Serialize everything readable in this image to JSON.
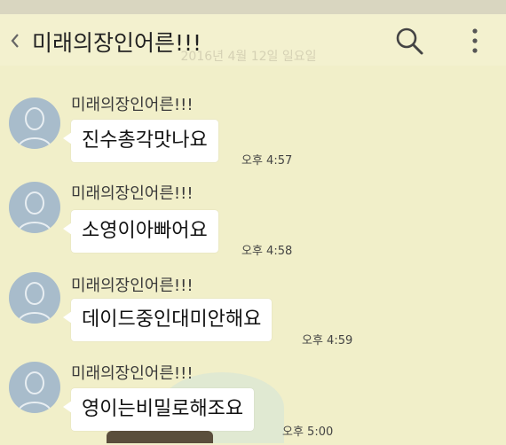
{
  "header": {
    "title": "미래의장인어른!!!"
  },
  "date_divider": "2016년 4월 12일 일요일",
  "messages": [
    {
      "sender": "미래의장인어른!!!",
      "text": "진수총각맛나요",
      "time": "오후 4:57"
    },
    {
      "sender": "미래의장인어른!!!",
      "text": "소영이아빠어요",
      "time": "오후 4:58"
    },
    {
      "sender": "미래의장인어른!!!",
      "text": "데이드중인대미안해요",
      "time": "오후 4:59"
    },
    {
      "sender": "미래의장인어른!!!",
      "text": "영이는비밀로해조요",
      "time": "오후 5:00"
    }
  ],
  "icons": {
    "back": "chevron-left-icon",
    "search": "search-icon",
    "more": "more-vertical-icon",
    "avatar": "default-profile-icon"
  },
  "colors": {
    "background": "#f1efc9",
    "bubble": "#ffffff",
    "avatar": "#a8bccb"
  }
}
